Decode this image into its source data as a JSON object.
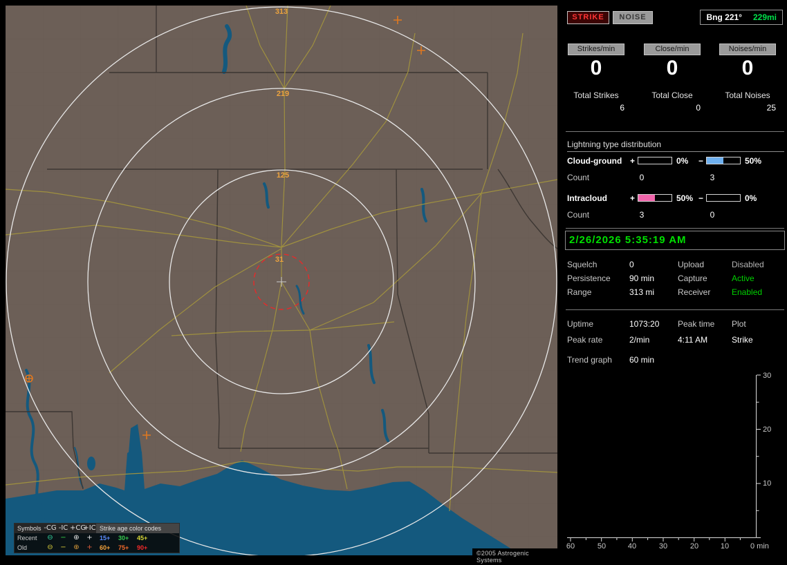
{
  "map": {
    "ring_labels": {
      "outer": "313",
      "second": "219",
      "third": "125",
      "inner": "31"
    },
    "copyright": "©2005 Astrogenic Systems",
    "legend": {
      "symbols_header": "Symbols",
      "columns": [
        "-CG",
        "-IC",
        "+CG",
        "+IC"
      ],
      "age_header": "Strike age color codes",
      "rows": [
        {
          "label": "Recent",
          "symbols": [
            {
              "glyph": "⊖",
              "color": "#35d6a0"
            },
            {
              "glyph": "−",
              "color": "#35d64a"
            },
            {
              "glyph": "⊕",
              "color": "#e8e8e8"
            },
            {
              "glyph": "+",
              "color": "#e8e8e8"
            }
          ],
          "ages": [
            {
              "text": "15+",
              "color": "#5b8cff"
            },
            {
              "text": "30+",
              "color": "#35c94f"
            },
            {
              "text": "45+",
              "color": "#d6d635"
            }
          ]
        },
        {
          "label": "Old",
          "symbols": [
            {
              "glyph": "⊖",
              "color": "#d8cc3a"
            },
            {
              "glyph": "−",
              "color": "#d8cc3a"
            },
            {
              "glyph": "⊕",
              "color": "#d89a3a"
            },
            {
              "glyph": "+",
              "color": "#d85a3a"
            }
          ],
          "ages": [
            {
              "text": "60+",
              "color": "#f2a23c"
            },
            {
              "text": "75+",
              "color": "#f26a2a"
            },
            {
              "text": "90+",
              "color": "#f22a2a"
            }
          ]
        }
      ]
    }
  },
  "panel": {
    "mode_buttons": {
      "strike": "STRIKE",
      "noise": "NOISE"
    },
    "bearing": {
      "label": "Bng 221°",
      "distance": "229mi",
      "distance_color": "#00e04a"
    },
    "rates": [
      {
        "button": "Strikes/min",
        "value": "0",
        "total_label": "Total Strikes",
        "total_value": "6"
      },
      {
        "button": "Close/min",
        "value": "0",
        "total_label": "Total Close",
        "total_value": "0"
      },
      {
        "button": "Noises/min",
        "value": "0",
        "total_label": "Total Noises",
        "total_value": "25"
      }
    ],
    "distribution": {
      "title": "Lightning type distribution",
      "rows": [
        {
          "label": "Cloud-ground",
          "plus_sign": "+",
          "plus_pct": "0%",
          "plus_color": "#6fb0ef",
          "minus_sign": "−",
          "minus_pct": "50%",
          "minus_color": "#6fb0ef",
          "count_label": "Count",
          "plus_count": "0",
          "minus_count": "3"
        },
        {
          "label": "Intracloud",
          "plus_sign": "+",
          "plus_pct": "50%",
          "plus_color": "#f065ab",
          "minus_sign": "−",
          "minus_pct": "0%",
          "minus_color": "#f065ab",
          "count_label": "Count",
          "plus_count": "3",
          "minus_count": "0"
        }
      ]
    },
    "datetime": {
      "text": "2/26/2026 5:35:19 AM",
      "color": "#00e000"
    },
    "settings": [
      {
        "label": "Squelch",
        "value": "0",
        "label2": "Upload",
        "value2": "Disabled",
        "value2_color": "#b4b4b4"
      },
      {
        "label": "Persistence",
        "value": "90 min",
        "label2": "Capture",
        "value2": "Active",
        "value2_color": "#00d000"
      },
      {
        "label": "Range",
        "value": "313 mi",
        "label2": "Receiver",
        "value2": "Enabled",
        "value2_color": "#00d000"
      }
    ],
    "stats": {
      "uptime_label": "Uptime",
      "uptime_value": "1073:20",
      "peak_time_label": "Peak time",
      "plot_label": "Plot",
      "peak_rate_label": "Peak rate",
      "peak_rate_value": "2/min",
      "peak_time_value": "4:11 AM",
      "plot_value": "Strike",
      "trend_label": "Trend graph",
      "trend_value": "60 min"
    },
    "graph": {
      "y_ticks": [
        "30",
        "20",
        "10"
      ],
      "x_ticks": [
        "60",
        "50",
        "40",
        "30",
        "20",
        "10"
      ],
      "origin_label": "0 min"
    }
  }
}
